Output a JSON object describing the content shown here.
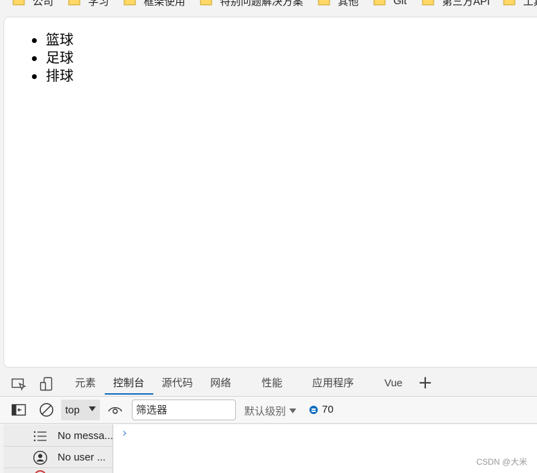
{
  "bookmarks": [
    {
      "label": "公司"
    },
    {
      "label": "学习"
    },
    {
      "label": "框架使用"
    },
    {
      "label": "特别问题解决方案"
    },
    {
      "label": "其他"
    },
    {
      "label": "Git"
    },
    {
      "label": "第三方API"
    },
    {
      "label": "工具"
    }
  ],
  "page": {
    "list": [
      "篮球",
      "足球",
      "排球"
    ]
  },
  "devtools": {
    "tabs": [
      "元素",
      "控制台",
      "源代码",
      "网络",
      "性能",
      "应用程序",
      "Vue"
    ],
    "active_tab": "控制台"
  },
  "console_toolbar": {
    "context": "top",
    "filter_placeholder": "筛选器",
    "levels_label": "默认级别",
    "issues_count": "70"
  },
  "console_sidebar": {
    "items": [
      {
        "label": "No messa...",
        "icon": "list-icon"
      },
      {
        "label": "No user ...",
        "icon": "user-icon"
      }
    ]
  },
  "console": {
    "prompt": "›"
  },
  "watermark": "CSDN @大米"
}
